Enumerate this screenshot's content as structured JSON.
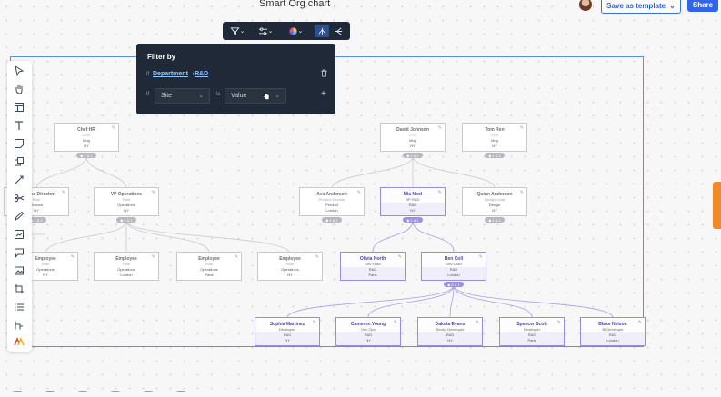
{
  "header": {
    "title": "Smart Org chart",
    "save_template": "Save as template",
    "share": "Share"
  },
  "colors": {
    "accent": "#3164e8",
    "highlight": "#9a8ce0",
    "panel": "#1f2937"
  },
  "left_toolbar": {
    "tools": [
      "select-icon",
      "hand-icon",
      "frame-icon",
      "text-icon",
      "sticky-note-icon",
      "shapes-icon",
      "connector-icon",
      "scissors-icon",
      "pen-icon",
      "chart-icon",
      "comment-icon",
      "image-icon",
      "crop-icon",
      "list-icon",
      "tree-icon",
      "apps-icon"
    ]
  },
  "floating_toolbar": {
    "items": [
      "filter-icon",
      "sliders-icon",
      "color-wheel-icon",
      "layout-up-icon",
      "layout-left-icon"
    ]
  },
  "filter_panel": {
    "title": "Filter by",
    "rule1": {
      "if": "if",
      "field": "Department",
      "is": "is",
      "value": "R&D"
    },
    "rule2": {
      "if": "if",
      "field": "Site",
      "is": "is",
      "value_placeholder": "Value"
    }
  },
  "org": {
    "nodes": [
      {
        "id": "chef",
        "name": "Chef HR",
        "title": "COO",
        "dept": "Mng",
        "loc": "NY",
        "badge": "◆ 1 & 1",
        "highlight": false
      },
      {
        "id": "david",
        "name": "David Johnson",
        "title": "CTO",
        "dept": "Mng",
        "loc": "NY",
        "badge": "◆ 2 & 1",
        "highlight": false
      },
      {
        "id": "tom",
        "name": "Tom Ren",
        "title": "CFO",
        "dept": "Mng",
        "loc": "NY",
        "badge": "◆ 1 & 1",
        "highlight": false
      },
      {
        "id": "fin",
        "name": "Finance Director",
        "title": "Role",
        "dept": "Finance",
        "loc": "NY",
        "badge": "◆ 1 & 1",
        "highlight": false
      },
      {
        "id": "vpops",
        "name": "VP Operations",
        "title": "Role",
        "dept": "Operations",
        "loc": "NY",
        "badge": "◆ 4 & 1",
        "highlight": false
      },
      {
        "id": "ava",
        "name": "Ava Anderson",
        "title": "Product Director",
        "dept": "Product",
        "loc": "London",
        "badge": "◆ 1 & 1",
        "highlight": false
      },
      {
        "id": "mia",
        "name": "Mia Noel",
        "title": "VP R&D",
        "dept": "R&D",
        "loc": "NY",
        "badge": "◆ 2 & 1",
        "highlight": true
      },
      {
        "id": "quinn",
        "name": "Quinn Anderson",
        "title": "Design Lead",
        "dept": "Design",
        "loc": "NY",
        "badge": "◆ 1 & 1",
        "highlight": false
      },
      {
        "id": "emp1",
        "name": "Employee",
        "title": "Role",
        "dept": "Operations",
        "loc": "NY",
        "badge": "",
        "highlight": false
      },
      {
        "id": "emp2",
        "name": "Employee",
        "title": "Role",
        "dept": "Operations",
        "loc": "London",
        "badge": "",
        "highlight": false
      },
      {
        "id": "emp3",
        "name": "Employee",
        "title": "Role",
        "dept": "Operations",
        "loc": "Paris",
        "badge": "",
        "highlight": false
      },
      {
        "id": "emp4",
        "name": "Employee",
        "title": "Role",
        "dept": "Operations",
        "loc": "NY",
        "badge": "",
        "highlight": false
      },
      {
        "id": "olivia",
        "name": "Olivia North",
        "title": "Dev Lead",
        "dept": "R&D",
        "loc": "Paris",
        "badge": "",
        "highlight": true
      },
      {
        "id": "ben",
        "name": "Ben Coll",
        "title": "Dev Lead",
        "dept": "R&D",
        "loc": "London",
        "badge": "◆ 5 & 1",
        "highlight": true
      },
      {
        "id": "sophia",
        "name": "Sophia Martinez",
        "title": "Developer",
        "dept": "R&D",
        "loc": "NY",
        "badge": "",
        "highlight": true
      },
      {
        "id": "cameron",
        "name": "Cameron Young",
        "title": "Dev Ops",
        "dept": "R&D",
        "loc": "NY",
        "badge": "",
        "highlight": true
      },
      {
        "id": "dakota",
        "name": "Dakota Evans",
        "title": "Senior Developer",
        "dept": "R&D",
        "loc": "NY",
        "badge": "",
        "highlight": true
      },
      {
        "id": "spencer",
        "name": "Spencer Scott",
        "title": "Developer",
        "dept": "R&D",
        "loc": "Paris",
        "badge": "",
        "highlight": true
      },
      {
        "id": "blake",
        "name": "Blake Nelson",
        "title": "BI Developer",
        "dept": "R&D",
        "loc": "London",
        "badge": "",
        "highlight": true
      }
    ]
  }
}
